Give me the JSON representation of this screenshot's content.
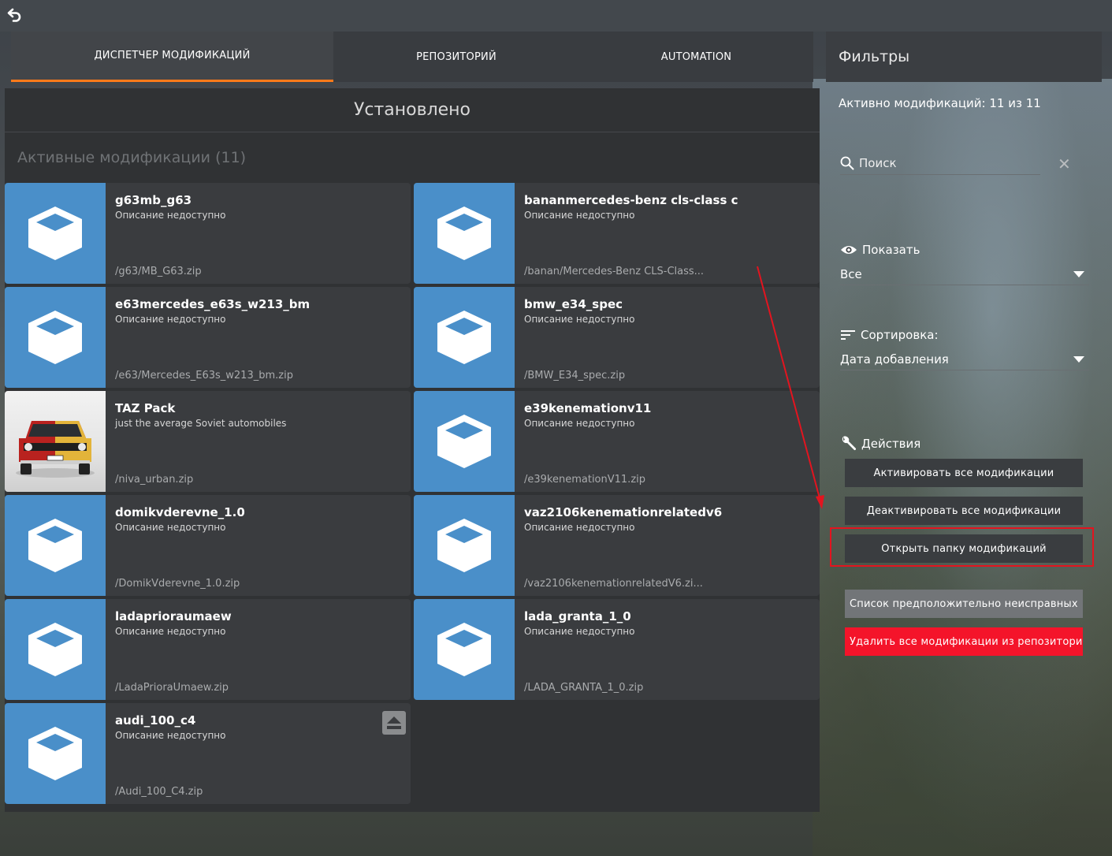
{
  "tabs": [
    {
      "label": "ДИСПЕТЧЕР МОДИФИКАЦИЙ",
      "active": true
    },
    {
      "label": "РЕПОЗИТОРИЙ",
      "active": false
    },
    {
      "label": "AUTOMATION",
      "active": false
    }
  ],
  "main": {
    "title": "Установлено",
    "subsection": "Активные модификации (11)"
  },
  "mods": [
    {
      "name": "g63mb_g63",
      "desc": "Описание недоступно",
      "path": "/g63/MB_G63.zip",
      "thumb": "box-icon"
    },
    {
      "name": "bananmercedes-benz cls-class c",
      "desc": "Описание недоступно",
      "path": "/banan/Mercedes-Benz CLS-Class...",
      "thumb": "box-icon"
    },
    {
      "name": "e63mercedes_e63s_w213_bm",
      "desc": "Описание недоступно",
      "path": "/e63/Mercedes_E63s_w213_bm.zip",
      "thumb": "box-icon"
    },
    {
      "name": "bmw_e34_spec",
      "desc": "Описание недоступно",
      "path": "/BMW_E34_spec.zip",
      "thumb": "box-icon"
    },
    {
      "name": "TAZ Pack",
      "desc": "just the average Soviet automobiles",
      "path": "/niva_urban.zip",
      "thumb": "car-photo"
    },
    {
      "name": "e39kenemationv11",
      "desc": "Описание недоступно",
      "path": "/e39kenemationV11.zip",
      "thumb": "box-icon"
    },
    {
      "name": "domikvderevne_1.0",
      "desc": "Описание недоступно",
      "path": "/DomikVderevne_1.0.zip",
      "thumb": "box-icon"
    },
    {
      "name": "vaz2106kenemationrelatedv6",
      "desc": "Описание недоступно",
      "path": "/vaz2106kenemationrelatedV6.zi...",
      "thumb": "box-icon"
    },
    {
      "name": "ladaprioraumaew",
      "desc": "Описание недоступно",
      "path": "/LadaPrioraUmaew.zip",
      "thumb": "box-icon"
    },
    {
      "name": "lada_granta_1_0",
      "desc": "Описание недоступно",
      "path": "/LADA_GRANTA_1_0.zip",
      "thumb": "box-icon"
    },
    {
      "name": "audi_100_c4",
      "desc": "Описание недоступно",
      "path": "/Audi_100_C4.zip",
      "thumb": "box-icon",
      "update": true
    }
  ],
  "filters": {
    "header": "Фильтры",
    "active_count": "Активно модификаций: 11 из 11",
    "search_placeholder": "Поиск",
    "show_label": "Показать",
    "show_value": "Все",
    "sort_label": "Сортировка:",
    "sort_value": "Дата добавления",
    "actions_label": "Действия",
    "actions": {
      "activate_all": "Активировать все модификации",
      "deactivate_all": "Деактивировать все модификации",
      "open_folder": "Открыть папку модификаций",
      "broken_list": "Список предположительно неисправных",
      "delete_all": "Удалить все модификации из репозитория"
    }
  },
  "colors": {
    "accent": "#ff7a1a",
    "thumb_blue": "#4a8fc9",
    "danger": "#f4142a",
    "highlight": "#e3141f"
  }
}
